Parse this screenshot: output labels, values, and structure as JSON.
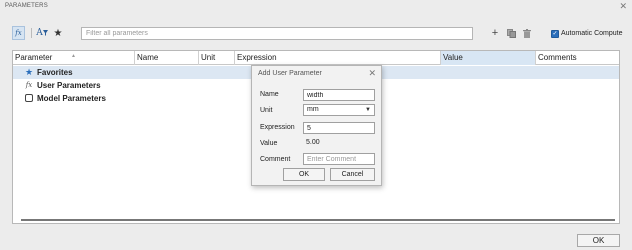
{
  "window": {
    "title": "PARAMETERS",
    "close_glyph": "✕"
  },
  "toolbar": {
    "fx_label": "fx",
    "fa_label": "A",
    "filter_placeholder": "Filter all parameters",
    "add_glyph": "+",
    "auto_compute_label": "Automatic Compute",
    "auto_compute_checked": true,
    "icons": [
      "fx-icon",
      "filter-by-name-icon",
      "star-icon",
      "plus-icon",
      "copy-icon",
      "trash-icon"
    ]
  },
  "table": {
    "columns": [
      "Parameter",
      "Name",
      "Unit",
      "Expression",
      "Value",
      "Comments"
    ],
    "rows": [
      {
        "label": "Favorites",
        "icon": "star-icon",
        "selected": true
      },
      {
        "label": "User Parameters",
        "icon": "fx-icon",
        "selected": false
      },
      {
        "label": "Model Parameters",
        "icon": "box-icon",
        "selected": false
      }
    ]
  },
  "footer": {
    "ok_label": "OK"
  },
  "dialog": {
    "title": "Add User Parameter",
    "name_label": "Name",
    "name_value": "width",
    "unit_label": "Unit",
    "unit_value": "mm",
    "expression_label": "Expression",
    "expression_value": "5",
    "value_label": "Value",
    "value_value": "5.00",
    "comment_label": "Comment",
    "comment_placeholder": "Enter Comment",
    "ok_label": "OK",
    "cancel_label": "Cancel"
  },
  "colors": {
    "accent": "#2a6ebb",
    "selection": "#dce7f3",
    "value_header": "#d8e6f4"
  }
}
